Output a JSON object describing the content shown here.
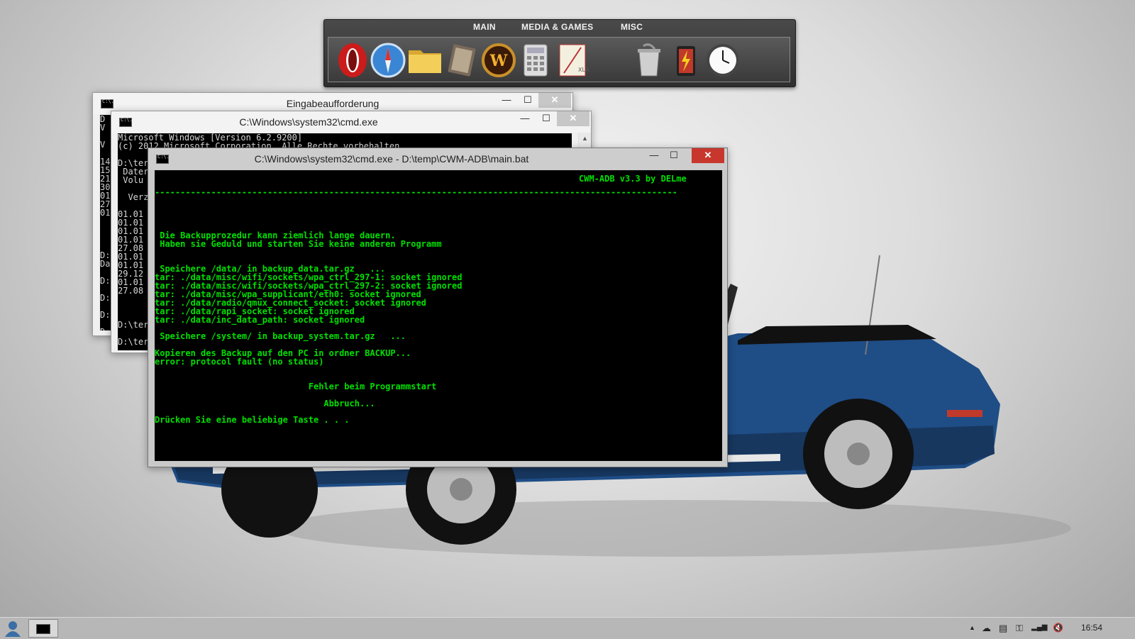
{
  "dock": {
    "tabs": [
      "MAIN",
      "MEDIA & GAMES",
      "MISC"
    ],
    "icons": [
      "opera-browser-icon",
      "safari-compass-icon",
      "folder-icon",
      "book-icon",
      "warcraft-icon",
      "calculator-icon",
      "notepad-icon",
      "recycle-bin-icon",
      "battery-icon",
      "clock-icon"
    ]
  },
  "windows": {
    "back": {
      "title": "Eingabeaufforderung",
      "lines": [
        "D",
        "V",
        "",
        "V",
        "",
        "14",
        "15",
        "21",
        "30",
        "01",
        "27",
        "01",
        "",
        "",
        "",
        "",
        "D:",
        "Da",
        "",
        "D:",
        "",
        "D:",
        "",
        "D:",
        "",
        "D:"
      ]
    },
    "middle": {
      "title": "C:\\Windows\\system32\\cmd.exe",
      "lines": [
        "Microsoft Windows [Version 6.2.9200]",
        "(c) 2012 Microsoft Corporation. Alle Rechte vorbehalten.",
        "",
        "D:\\ter",
        " Dater",
        " Volu",
        "",
        "  Verze",
        "",
        "01.01",
        "01.01",
        "01.01",
        "01.01",
        "27.08",
        "01.01",
        "01.01",
        "29.12",
        "01.01",
        "27.08",
        "",
        "",
        "",
        "D:\\ter",
        "",
        "D:\\ter"
      ]
    },
    "main": {
      "title": "C:\\Windows\\system32\\cmd.exe - D:\\temp\\CWM-ADB\\main.bat",
      "header": "CWM-ADB v3.3 by DELme",
      "separator": "------------------------------------------------------------------------------------------------------",
      "lines": [
        " Die Backupprozedur kann ziemlich lange dauern.",
        " Haben sie Geduld und starten Sie keine anderen Programm",
        " Speichere /data/ in backup_data.tar.gz   ...",
        "tar: ./data/misc/wifi/sockets/wpa_ctrl_297-1: socket ignored",
        "tar: ./data/misc/wifi/sockets/wpa_ctrl_297-2: socket ignored",
        "tar: ./data/misc/wpa_supplicant/eth0: socket ignored",
        "tar: ./data/radio/qmux_connect_socket: socket ignored",
        "tar: ./data/rapi_socket: socket ignored",
        "tar: ./data/inc_data_path: socket ignored",
        " Speichere /system/ in backup_system.tar.gz   ...",
        "Kopieren des Backup auf den PC in ordner BACKUP...",
        "error: protocol fault (no status)",
        "                              Fehler beim Programmstart",
        "                                 Abbruch...",
        "Drücken Sie eine beliebige Taste . . ."
      ]
    }
  },
  "window_buttons": {
    "minimize": "—",
    "maximize": "☐",
    "close": "✕"
  },
  "taskbar": {
    "clock": "16:54",
    "tray_icons": [
      "show-hidden-icons-arrow",
      "onedrive-cloud-icon",
      "keyboard-icon",
      "network-icon",
      "signal-bars-icon",
      "volume-muted-icon"
    ],
    "tray_glyphs": [
      "▲",
      "☁",
      "▤",
      "⚿",
      "▂▄▆",
      "🔇"
    ]
  },
  "colors": {
    "console_green": "#00e000",
    "close_red": "#c8372d"
  }
}
